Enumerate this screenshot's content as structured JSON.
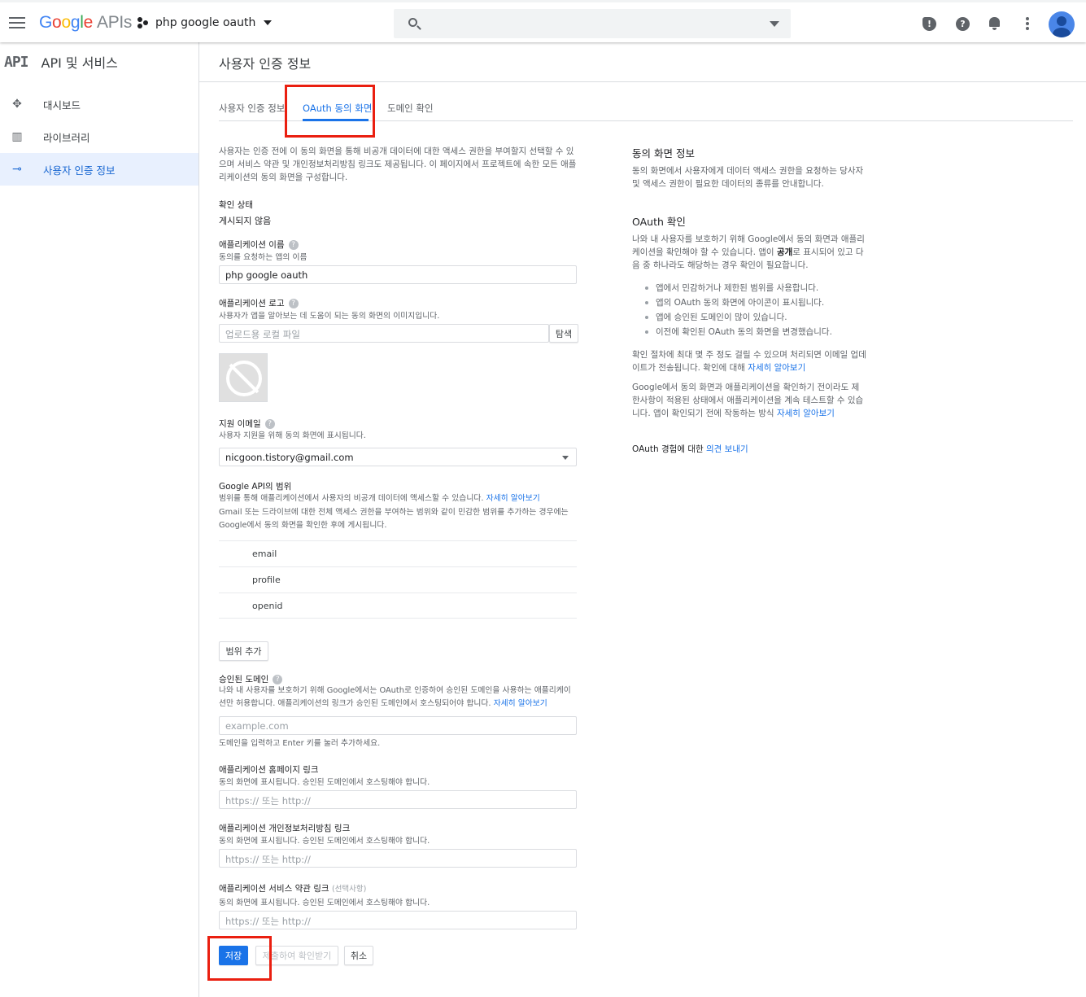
{
  "topbar": {
    "logo_parts": [
      "G",
      "o",
      "o",
      "g",
      "l",
      "e"
    ],
    "logo_suffix": "APIs",
    "project_name": "php google oauth",
    "icons": [
      "menu-icon",
      "search-icon",
      "dropdown-icon",
      "feedback-icon",
      "help-icon",
      "notifications-icon",
      "more-vert-icon",
      "account-avatar"
    ]
  },
  "sidebar": {
    "badge": "API",
    "title": "API 및 서비스",
    "items": [
      {
        "label": "대시보드",
        "icon": "dashboard-icon"
      },
      {
        "label": "라이브러리",
        "icon": "library-icon"
      },
      {
        "label": "사용자 인증 정보",
        "icon": "key-icon",
        "active": true
      }
    ]
  },
  "page": {
    "title": "사용자 인증 정보",
    "tabs": [
      "사용자 인증 정보",
      "OAuth 동의 화면",
      "도메인 확인"
    ]
  },
  "form": {
    "intro": "사용자는 인증 전에 이 동의 화면을 통해 비공개 데이터에 대한 액세스 권한을 부여할지 선택할 수 있으며 서비스 약관 및 개인정보처리방침 링크도 제공됩니다. 이 페이지에서 프로젝트에 속한 모든 애플리케이션의 동의 화면을 구성합니다.",
    "status_label": "확인 상태",
    "status_value": "게시되지 않음",
    "app_name_label": "애플리케이션 이름",
    "app_name_sub": "동의를 요청하는 앱의 이름",
    "app_name_value": "php google oauth",
    "app_logo_label": "애플리케이션 로고",
    "app_logo_sub": "사용자가 앱을 알아보는 데 도움이 되는 동의 화면의 이미지입니다.",
    "logo_placeholder": "업로드용 로컬 파일",
    "browse_label": "탐색",
    "support_email_label": "지원 이메일",
    "support_email_sub": "사용자 지원을 위해 동의 화면에 표시됩니다.",
    "support_email_value": "nicgoon.tistory@gmail.com",
    "scopes_label": "Google API의 범위",
    "scopes_sub": "범위를 통해 애플리케이션에서 사용자의 비공개 데이터에 액세스할 수 있습니다.",
    "scopes_link": "자세히 알아보기",
    "scopes_note": "Gmail 또는 드라이브에 대한 전체 액세스 권한을 부여하는 범위와 같이 민감한 범위를 추가하는 경우에는 Google에서 동의 화면을 확인한 후에 게시됩니다.",
    "scopes": [
      "email",
      "profile",
      "openid"
    ],
    "add_scope_label": "범위 추가",
    "domains_label": "승인된 도메인",
    "domains_sub": "나와 내 사용자를 보호하기 위해 Google에서는 OAuth로 인증하여 승인된 도메인을 사용하는 애플리케이션만 허용합니다. 애플리케이션의 링크가 승인된 도메인에서 호스팅되어야 합니다.",
    "domains_link": "자세히 알아보기",
    "domains_placeholder": "example.com",
    "domains_hint": "도메인을 입력하고 Enter 키를 눌러 추가하세요.",
    "homepage_label": "애플리케이션 홈페이지 링크",
    "homepage_sub": "동의 화면에 표시됩니다. 승인된 도메인에서 호스팅해야 합니다.",
    "privacy_label": "애플리케이션 개인정보처리방침 링크",
    "privacy_sub": "동의 화면에 표시됩니다. 승인된 도메인에서 호스팅해야 합니다.",
    "tos_label": "애플리케이션 서비스 약관 링크",
    "tos_optional": "(선택사항)",
    "tos_sub": "동의 화면에 표시됩니다. 승인된 도메인에서 호스팅해야 합니다.",
    "url_placeholder": "https:// 또는 http://",
    "save_label": "저장",
    "submit_label": "제출하여 확인받기",
    "cancel_label": "취소"
  },
  "info": {
    "consent_title": "동의 화면 정보",
    "consent_text": "동의 화면에서 사용자에게 데이터 액세스 권한을 요청하는 당사자 및 액세스 권한이 필요한 데이터의 종류를 안내합니다.",
    "verify_title": "OAuth 확인",
    "verify_text_1": "나와 내 사용자를 보호하기 위해 Google에서 동의 화면과 애플리케이션을 확인해야 할 수 있습니다. 앱이 ",
    "verify_bold": "공개",
    "verify_text_2": "로 표시되어 있고 다음 중 하나라도 해당하는 경우 확인이 필요합니다.",
    "bullets": [
      "앱에서 민감하거나 제한된 범위를 사용합니다.",
      "앱의 OAuth 동의 화면에 아이콘이 표시됩니다.",
      "앱에 승인된 도메인이 많이 있습니다.",
      "이전에 확인된 OAuth 동의 화면을 변경했습니다."
    ],
    "process_text": "확인 절차에 최대 몇 주 정도 걸릴 수 있으며 처리되면 이메일 업데이트가 전송됩니다. 확인에 대해 ",
    "process_link": "자세히 알아보기",
    "test_text": "Google에서 동의 화면과 애플리케이션을 확인하기 전이라도 제한사항이 적용된 상태에서 애플리케이션을 계속 테스트할 수 있습니다. 앱이 확인되기 전에 작동하는 방식 ",
    "test_link": "자세히 알아보기",
    "feedback_text": "OAuth 경험에 대한 ",
    "feedback_link": "의견 보내기"
  },
  "colors": {
    "accent": "#1a73e8",
    "highlight": "#ea1f10"
  }
}
